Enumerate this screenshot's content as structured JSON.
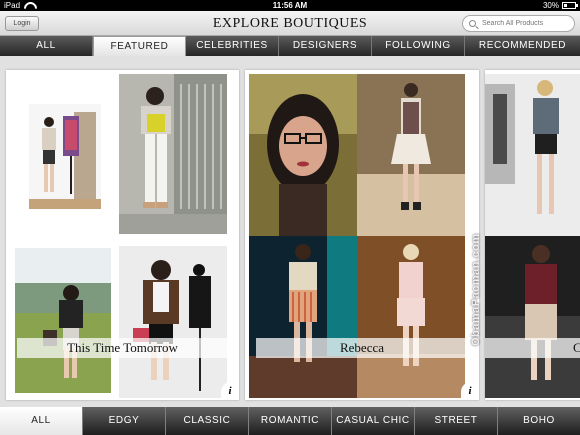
{
  "status_bar": {
    "device": "iPad",
    "time": "11:56 AM",
    "battery": "30%",
    "battery_level": 0.3
  },
  "header": {
    "login_label": "Login",
    "title": "EXPLORE BOUTIQUES",
    "search_placeholder": "Search All Products"
  },
  "top_tabs": [
    {
      "label": "ALL",
      "active": false
    },
    {
      "label": "FEATURED",
      "active": true
    },
    {
      "label": "CELEBRITIES",
      "active": false
    },
    {
      "label": "DESIGNERS",
      "active": false
    },
    {
      "label": "FOLLOWING",
      "active": false
    },
    {
      "label": "RECOMMENDED",
      "active": false
    }
  ],
  "boutiques": [
    {
      "name": "This Time Tomorrow",
      "info": "i"
    },
    {
      "name": "Rebecca",
      "info": "i"
    },
    {
      "name": "C",
      "info": ""
    }
  ],
  "watermark": "ObamaPacman.com",
  "bottom_tabs": [
    {
      "label": "ALL",
      "active": true
    },
    {
      "label": "EDGY",
      "active": false
    },
    {
      "label": "CLASSIC",
      "active": false
    },
    {
      "label": "ROMANTIC",
      "active": false
    },
    {
      "label": "CASUAL CHIC",
      "active": false
    },
    {
      "label": "STREET",
      "active": false
    },
    {
      "label": "BOHO",
      "active": false
    }
  ],
  "colors": {
    "tab_bar": "#2a2a2a",
    "active_tab": "#ffffff",
    "content_bg": "#e1e1e1"
  }
}
